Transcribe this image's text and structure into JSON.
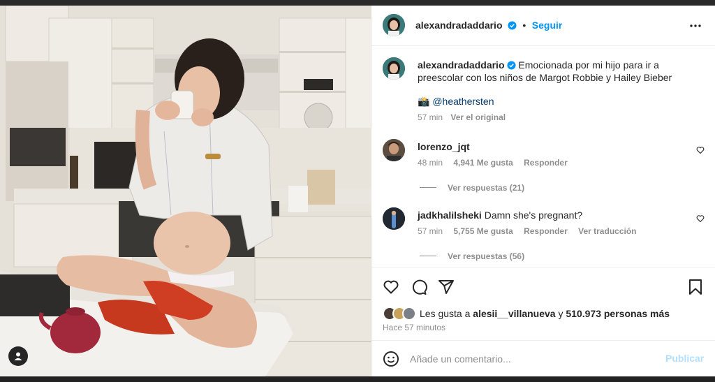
{
  "post": {
    "author": "alexandradaddario",
    "follow_label": "Seguir",
    "caption": "Emocionada por mi hijo para ir a preescolar con los niños de Margot Robbie y Hailey Bieber",
    "credit_emoji": "📸",
    "credit_handle": "@heathersten",
    "caption_time": "57 min",
    "see_original": "Ver el original"
  },
  "comments": [
    {
      "user": "lorenzo_jqt",
      "text": "",
      "time": "48 min",
      "likes": "4,941 Me gusta",
      "reply_label": "Responder",
      "translate_label": "",
      "view_replies": "Ver respuestas (21)"
    },
    {
      "user": "jadkhalilsheki",
      "text": "Damn she's pregnant?",
      "time": "57 min",
      "likes": "5,755 Me gusta",
      "reply_label": "Responder",
      "translate_label": "Ver traducción",
      "view_replies": "Ver respuestas (56)"
    }
  ],
  "likes_line": {
    "prefix": "Les gusta a",
    "user": "alesii__villanueva",
    "joiner": "y",
    "others": "510.973 personas más"
  },
  "posted_ago": "Hace 57 minutos",
  "composer": {
    "placeholder": "Añade un comentario...",
    "publish_label": "Publicar"
  },
  "colors": {
    "accent": "#0095f6",
    "verified": "#0095f6",
    "text": "#262626",
    "muted": "#8e8e8e",
    "publish_disabled": "#b2dffc"
  },
  "icons": [
    "more-icon",
    "heart-icon",
    "comment-icon",
    "share-icon",
    "bookmark-icon",
    "emoji-icon",
    "user-tag-icon"
  ]
}
